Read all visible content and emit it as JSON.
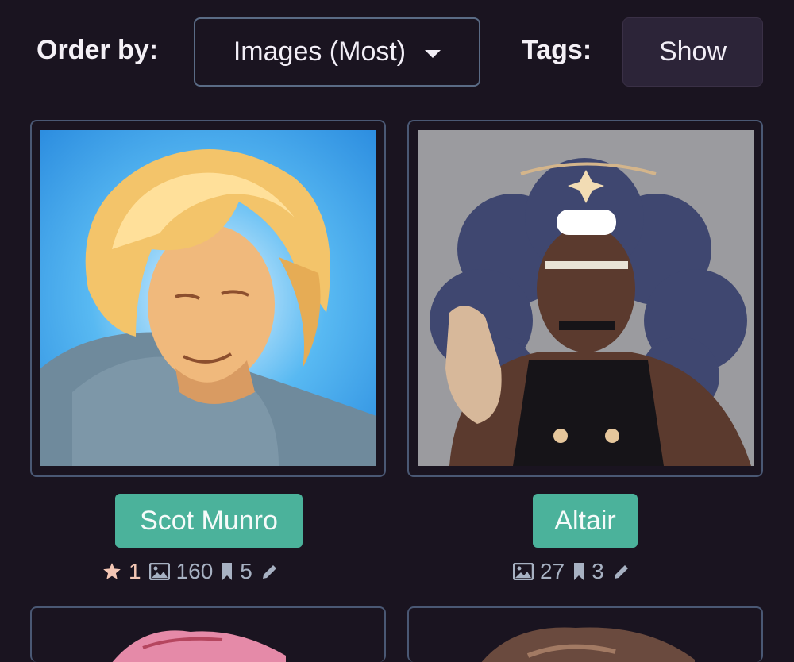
{
  "toolbar": {
    "order_label": "Order by:",
    "order_value": "Images (Most)",
    "tags_label": "Tags:",
    "show_label": "Show"
  },
  "colors": {
    "background": "#1a1420",
    "accent_name": "#4bb29b",
    "card_border": "#4a5874",
    "star": "#f3c6b4"
  },
  "cards": [
    {
      "name": "Scot Munro",
      "favorites": "1",
      "images": "160",
      "bookmarks": "5",
      "icons": [
        "star-icon",
        "image-icon",
        "bookmark-icon",
        "pencil-icon"
      ]
    },
    {
      "name": "Altair",
      "images": "27",
      "bookmarks": "3",
      "icons": [
        "image-icon",
        "bookmark-icon",
        "pencil-icon"
      ]
    }
  ]
}
